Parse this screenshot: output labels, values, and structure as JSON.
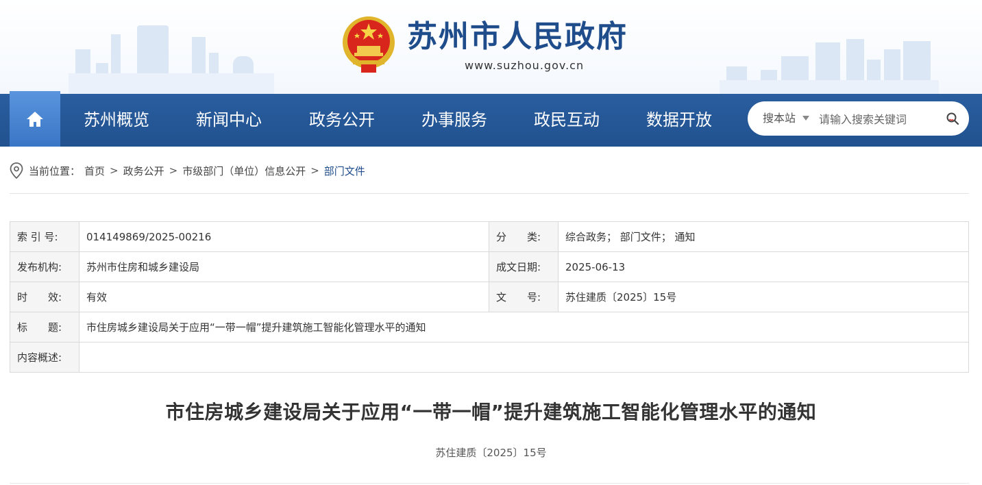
{
  "header": {
    "site_title": "苏州市人民政府",
    "site_url": "www.suzhou.gov.cn",
    "brand_color": "#1f4c8a"
  },
  "nav": {
    "home_icon": "home-icon",
    "items": [
      {
        "label": "苏州概览"
      },
      {
        "label": "新闻中心"
      },
      {
        "label": "政务公开"
      },
      {
        "label": "办事服务"
      },
      {
        "label": "政民互动"
      },
      {
        "label": "数据开放"
      }
    ],
    "search": {
      "scope": "搜本站",
      "placeholder": "请输入搜索关键词",
      "icon": "search-icon"
    },
    "bar_color": "#2a5e9f"
  },
  "breadcrumb": {
    "prefix": "当前位置：",
    "items": [
      "首页",
      "政务公开",
      "市级部门（单位）信息公开",
      "部门文件"
    ],
    "icon": "location-pin-icon"
  },
  "info": {
    "index_label": "索 引 号:",
    "index_value": "014149869/2025-00216",
    "category_label": "分　　类:",
    "category_value": "综合政务； 部门文件； 通知",
    "publisher_label": "发布机构:",
    "publisher_value": "苏州市住房和城乡建设局",
    "date_label": "成文日期:",
    "date_value": "2025-06-13",
    "validity_label": "时　　效:",
    "validity_value": "有效",
    "docno_label": "文　　号:",
    "docno_value": "苏住建质〔2025〕15号",
    "title_label": "标　　题:",
    "title_value": "市住房城乡建设局关于应用“一带一帽”提升建筑施工智能化管理水平的通知",
    "summary_label": "内容概述:",
    "summary_value": ""
  },
  "article": {
    "title": "市住房城乡建设局关于应用“一带一帽”提升建筑施工智能化管理水平的通知",
    "doc_number": "苏住建质〔2025〕15号"
  }
}
